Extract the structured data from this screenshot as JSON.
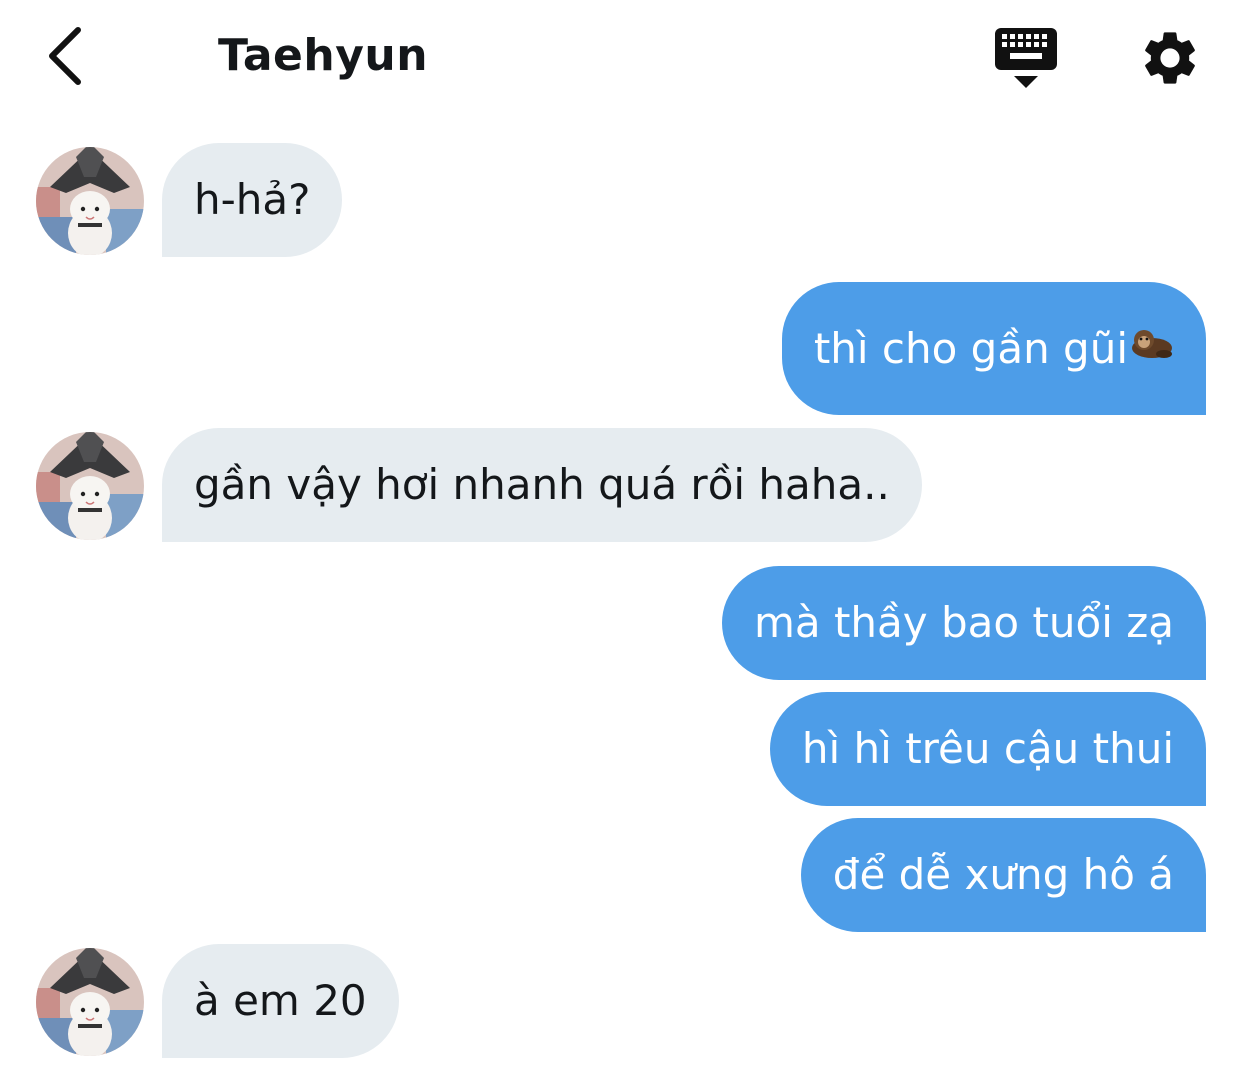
{
  "header": {
    "title": "Taehyun",
    "back_icon": "chevron-left-icon",
    "keyboard_icon": "keyboard-icon",
    "settings_icon": "gear-icon"
  },
  "messages": [
    {
      "direction": "incoming",
      "text": "h-hả?"
    },
    {
      "direction": "outgoing",
      "text": "thì cho gần gũi",
      "emoji": "otter-emoji"
    },
    {
      "direction": "incoming",
      "text": "gần vậy hơi nhanh quá rồi haha.."
    },
    {
      "direction": "outgoing",
      "text": "mà thầy bao tuổi zạ"
    },
    {
      "direction": "outgoing",
      "text": "hì hì trêu cậu thui"
    },
    {
      "direction": "outgoing",
      "text": "để dễ xưng hô á"
    },
    {
      "direction": "incoming",
      "text": "à em 20"
    }
  ],
  "colors": {
    "incoming_bubble": "#e6ecf0",
    "outgoing_bubble": "#4d9de8",
    "outgoing_text": "#ffffff",
    "incoming_text": "#14171a"
  }
}
